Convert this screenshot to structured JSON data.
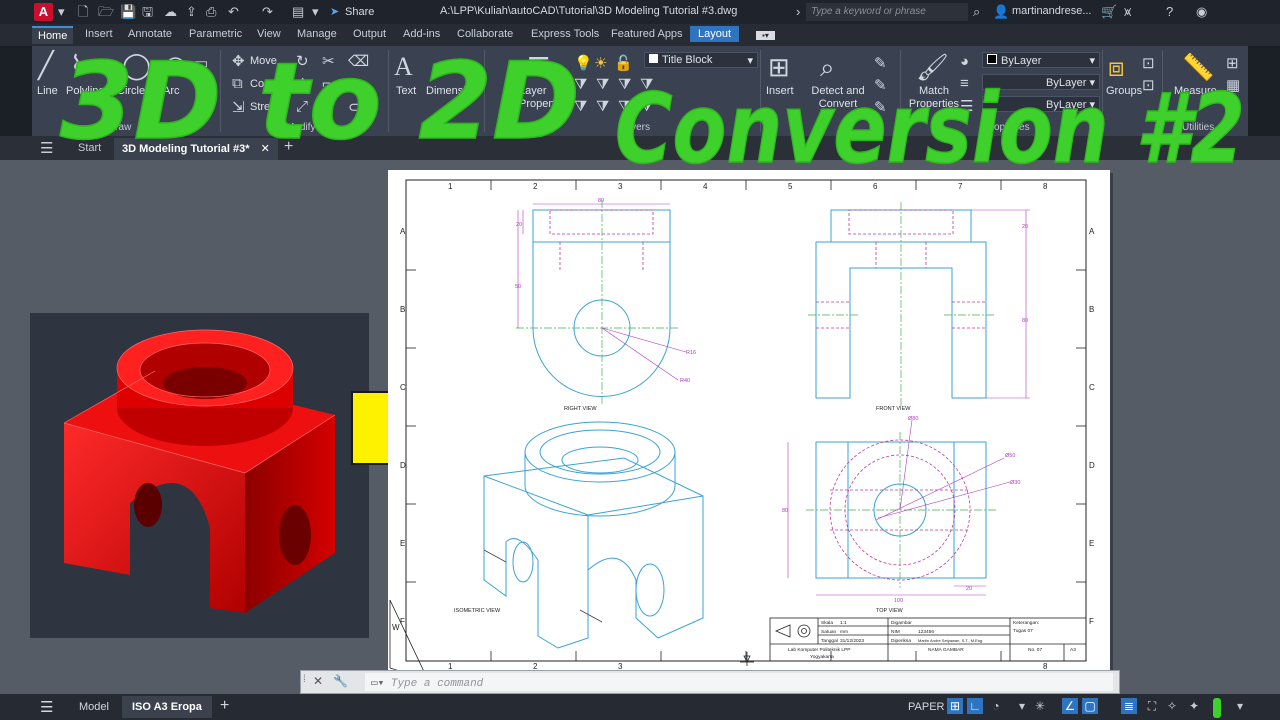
{
  "titlebar": {
    "logo": "A",
    "share": "Share",
    "document_path": "A:\\LPP\\Kuliah\\autoCAD\\Tutorial\\3D Modeling Tutorial #3.dwg",
    "search_placeholder": "Type a keyword or phrase",
    "user": "martinandrese..."
  },
  "ribbon_tabs": [
    "Home",
    "Insert",
    "Annotate",
    "Parametric",
    "View",
    "Manage",
    "Output",
    "Add-ins",
    "Collaborate",
    "Express Tools",
    "Featured Apps",
    "Layout"
  ],
  "ribbon": {
    "draw": {
      "line": "Line",
      "polyline": "Polyline",
      "circle": "Circle",
      "arc": "Arc",
      "label": "Draw"
    },
    "modify": {
      "move": "Move",
      "copy": "Copy",
      "stretch": "Stretch",
      "label": "Modify"
    },
    "annotation": {
      "text": "Text",
      "dimension": "Dimension"
    },
    "layers": {
      "layer_properties": "Layer Properties",
      "current_layer": "Title Block",
      "label": "Layers"
    },
    "block": {
      "insert": "Insert",
      "detect": "Detect and Convert"
    },
    "properties": {
      "match": "Match Properties",
      "color": "ByLayer",
      "linetype": "ByLayer",
      "lineweight": "ByLayer",
      "label": "Properties"
    },
    "groups": {
      "label": "Groups"
    },
    "utilities": {
      "measure": "Measure",
      "label": "Utilities"
    }
  },
  "file_tabs": {
    "start": "Start",
    "current": "3D Modeling Tutorial #3*"
  },
  "overlay": {
    "line1": "3D to 2D",
    "line2": "Conversion #2"
  },
  "drawing": {
    "columns": [
      "1",
      "2",
      "3",
      "4",
      "5",
      "6",
      "7",
      "8"
    ],
    "rows": [
      "A",
      "B",
      "C",
      "D",
      "E",
      "F"
    ],
    "views": {
      "right": "RIGHT VIEW",
      "front": "FRONT VIEW",
      "iso": "ISOMETRIC VIEW",
      "top": "TOP VIEW"
    },
    "dims": {
      "r_width": "80",
      "r_top": "20",
      "r_height": "50",
      "r16": "R16",
      "r40": "R40",
      "f_top": "20",
      "f_h": "80",
      "t_d": "Ø80",
      "t_d2": "Ø30",
      "t_d3": "Ø50",
      "t_h": "80",
      "t_w": "100",
      "t_small": "20"
    },
    "title_block": {
      "skala_label": "Skala",
      "skala": "1:1",
      "satuan_label": "Satuan",
      "satuan": "mm",
      "tanggal_label": "Tanggal",
      "tanggal": "31/12/2023",
      "digambar_label": "Digambar",
      "nim_label": "NIM",
      "nim": "123456",
      "diperiksa_label": "Diperiksa",
      "diperiksa": "Martin Andre Setyawan, S.T., M.Eng.",
      "keterangan_label": "Keterangan:",
      "keterangan": "Tugas 07",
      "lab": "Lab Komputer Politeknik LPP",
      "kota": "Yogyakarta",
      "nama": "NAMA GAMBAR",
      "no": "No. 07",
      "size": "A3"
    }
  },
  "command": {
    "placeholder": "Type a command"
  },
  "status": {
    "model": "Model",
    "layout": "ISO A3 Eropa",
    "paper": "PAPER"
  }
}
